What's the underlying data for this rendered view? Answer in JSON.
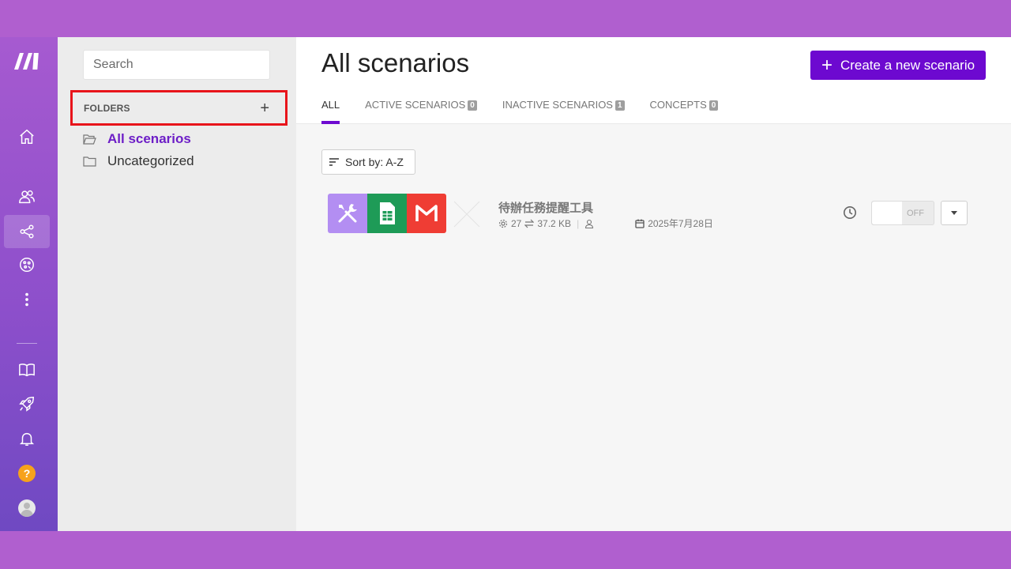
{
  "colors": {
    "accent": "#6d09d0",
    "page_background": "#b05fcf",
    "highlight_box": "#e8141b",
    "tools_icon_bg": "#b38ef2",
    "sheets_icon_bg": "#1e9b57",
    "gmail_icon_bg": "#ef3d34"
  },
  "rail": {
    "logo": "make-logo-icon",
    "items": [
      {
        "icon": "home-icon"
      },
      {
        "icon": "team-icon"
      },
      {
        "icon": "scenarios-share-icon",
        "active": true
      },
      {
        "icon": "templates-icon"
      },
      {
        "icon": "more-icon"
      },
      {
        "icon": "docs-book-icon"
      },
      {
        "icon": "rocket-icon"
      },
      {
        "icon": "bell-icon"
      },
      {
        "icon": "help-icon",
        "label": "?"
      },
      {
        "icon": "avatar-icon"
      }
    ]
  },
  "folders": {
    "search_placeholder": "Search",
    "header_label": "FOLDERS",
    "add_label": "+",
    "items": [
      {
        "label": "All scenarios",
        "active": true
      },
      {
        "label": "Uncategorized",
        "active": false
      }
    ]
  },
  "main": {
    "title": "All scenarios",
    "create_button_label": "Create a new scenario",
    "tabs": [
      {
        "label": "ALL",
        "badge": "",
        "active": true
      },
      {
        "label": "ACTIVE SCENARIOS",
        "badge": "0"
      },
      {
        "label": "INACTIVE SCENARIOS",
        "badge": "1"
      },
      {
        "label": "CONCEPTS",
        "badge": "0"
      }
    ],
    "sort_label": "Sort by: A-Z",
    "scenario": {
      "name": "待辦任務提醒工具",
      "operations": "27",
      "data_transfer": "37.2 KB",
      "date": "2025年7月28日",
      "toggle_state": "OFF",
      "apps": [
        "tools-icon",
        "google-sheets-icon",
        "gmail-icon"
      ]
    }
  }
}
